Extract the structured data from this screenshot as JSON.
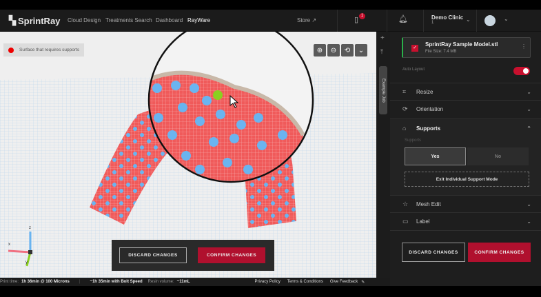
{
  "header": {
    "logo": "SprintRay",
    "nav": [
      "Cloud Design",
      "Treatments Search",
      "Dashboard",
      "RayWare"
    ],
    "store": "Store",
    "badge_count": "1",
    "clinic_name": "Demo Clinic",
    "clinic_sub": "1"
  },
  "viewport": {
    "legend": "Surface that requires supports",
    "legend_color": "#e00000",
    "axes": {
      "x": "x",
      "z": "z",
      "y": "y"
    },
    "discard": "DISCARD CHANGES",
    "confirm": "CONFIRM CHANGES"
  },
  "sidestrip": {
    "tab": "Example Job"
  },
  "panel": {
    "file_name": "SprintRay Sample Model.stl",
    "file_size": "File Size: 7.4 MB",
    "auto_layout": "Auto Layout",
    "auto_layout_on": true,
    "sections": {
      "resize": "Resize",
      "orientation": "Orientation",
      "supports": "Supports",
      "mesh_edit": "Mesh Edit",
      "label": "Label"
    },
    "supports_label": "Supports",
    "yes": "Yes",
    "no": "No",
    "exit_mode": "Exit Individual Support Mode",
    "discard": "DISCARD CHANGES",
    "confirm": "CONFIRM CHANGES"
  },
  "footer": {
    "print_time_label": "Print time:",
    "print_time": "1h 36min @ 100 Microns",
    "bolt": "~1h 35min with Bolt Speed",
    "resin_label": "Resin volume:",
    "resin": "~11mL",
    "privacy": "Privacy Policy",
    "terms": "Terms & Conditions",
    "feedback": "Give Feedback"
  },
  "colors": {
    "accent": "#c8102e",
    "model": "#f05a5a",
    "support": "#6ab4f0"
  }
}
